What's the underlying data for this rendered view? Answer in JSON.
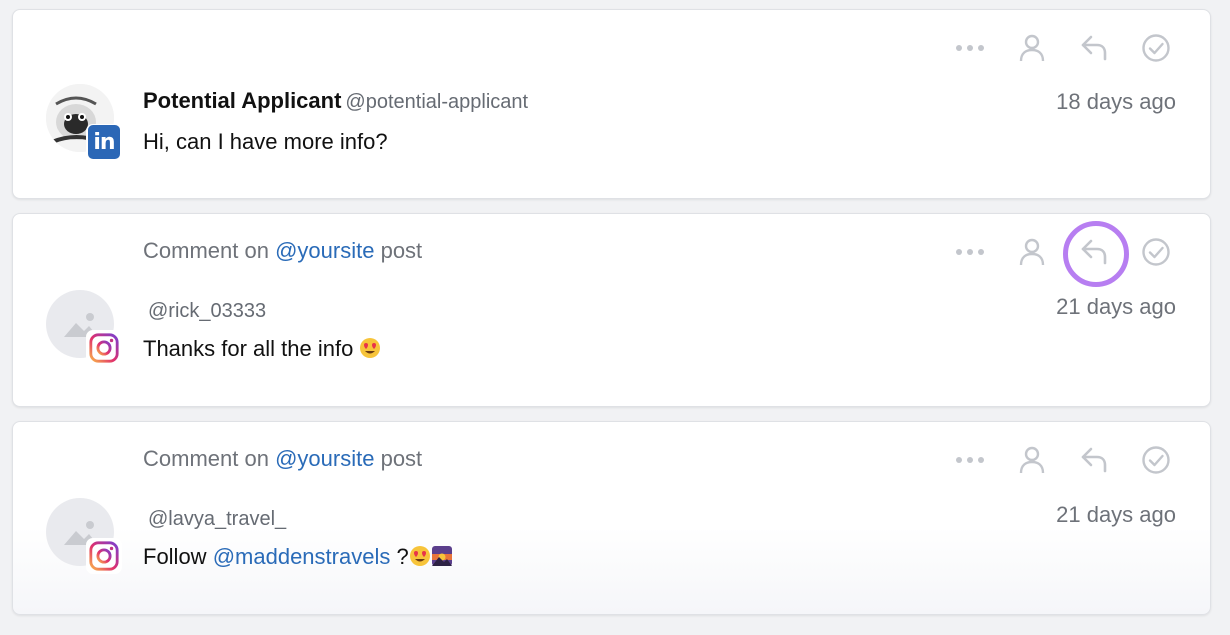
{
  "conversations": [
    {
      "network": "linkedin",
      "network_badge_text": "in",
      "name": "Potential Applicant",
      "handle": "@potential-applicant",
      "message": "Hi, can I have more info?",
      "time": "18 days ago",
      "actions": [
        "more-icon",
        "assign-user-icon",
        "reply-icon",
        "check-circle-icon"
      ]
    },
    {
      "network": "instagram",
      "context_prefix": "Comment on",
      "context_mention": "@yoursite",
      "context_suffix": "post",
      "handle": "@rick_03333",
      "message_text": "Thanks for all the info",
      "message_emoji": "heart-eyes-emoji",
      "time": "21 days ago",
      "actions": [
        "more-icon",
        "assign-user-icon",
        "reply-icon",
        "check-circle-icon"
      ],
      "highlighted_action": "reply-icon"
    },
    {
      "network": "instagram",
      "context_prefix": "Comment on",
      "context_mention": "@yoursite",
      "context_suffix": "post",
      "handle": "@lavya_travel_",
      "message_prefix": "Follow",
      "message_mention": "@maddenstravels",
      "message_suffix": "?",
      "message_emojis": [
        "heart-eyes-emoji",
        "sunset-emoji"
      ],
      "time": "21 days ago",
      "actions": [
        "more-icon",
        "assign-user-icon",
        "reply-icon",
        "check-circle-icon"
      ]
    }
  ],
  "colors": {
    "mention": "#2a6bb8",
    "highlight": "#b77ef1",
    "icon": "#c3c6cc",
    "linkedin": "#2b67b6"
  }
}
